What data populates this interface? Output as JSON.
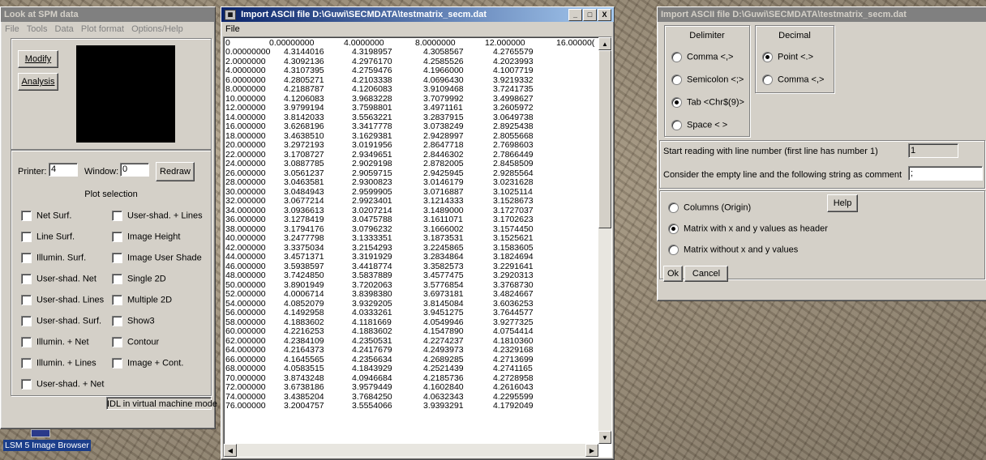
{
  "spm_window": {
    "title": "Look at SPM data",
    "menu": [
      "File",
      "Tools",
      "Data",
      "Plot format",
      "Options/Help"
    ],
    "modify_label": "Modify",
    "analysis_label": "Analysis",
    "printer_label": "Printer:",
    "printer_value": "4",
    "window_label": "Window:",
    "window_value": "0",
    "redraw_label": "Redraw",
    "plot_selection_title": "Plot selection",
    "plot_options_left": [
      "Net Surf.",
      "Line Surf.",
      "Illumin. Surf.",
      "User-shad. Net",
      "User-shad. Lines",
      "User-shad. Surf.",
      "Illumin. + Net",
      "Illumin. + Lines",
      "User-shad. + Net"
    ],
    "plot_options_right": [
      "User-shad. + Lines",
      "Image Height",
      "Image User Shade",
      "Single 2D",
      "Multiple 2D",
      "Show3",
      "Contour",
      "Image + Cont."
    ],
    "status_text": "IDL in virtual machine mode"
  },
  "import_table_window": {
    "title": "Import ASCII file D:\\Guwi\\SECMDATA\\testmatrix_secm.dat",
    "menu_file": "File",
    "minimize_glyph": "_",
    "maximize_glyph": "□",
    "close_glyph": "X",
    "header_row": [
      "0",
      "0.00000000",
      "4.0000000",
      "8.0000000",
      "12.000000",
      "16.00000("
    ],
    "rows": [
      [
        "0.00000000",
        "4.3144016",
        "4.3198957",
        "4.3058567",
        "4.2765579"
      ],
      [
        "2.0000000",
        "4.3092136",
        "4.2976170",
        "4.2585526",
        "4.2023993"
      ],
      [
        "4.0000000",
        "4.3107395",
        "4.2759476",
        "4.1966000",
        "4.1007719"
      ],
      [
        "6.0000000",
        "4.2805271",
        "4.2103338",
        "4.0696430",
        "3.9219332"
      ],
      [
        "8.0000000",
        "4.2188787",
        "4.1206083",
        "3.9109468",
        "3.7241735"
      ],
      [
        "10.000000",
        "4.1206083",
        "3.9683228",
        "3.7079992",
        "3.4998627"
      ],
      [
        "12.000000",
        "3.9799194",
        "3.7598801",
        "3.4971161",
        "3.2605972"
      ],
      [
        "14.000000",
        "3.8142033",
        "3.5563221",
        "3.2837915",
        "3.0649738"
      ],
      [
        "16.000000",
        "3.6268196",
        "3.3417778",
        "3.0738249",
        "2.8925438"
      ],
      [
        "18.000000",
        "3.4638510",
        "3.1629381",
        "2.9428997",
        "2.8055668"
      ],
      [
        "20.000000",
        "3.2972193",
        "3.0191956",
        "2.8647718",
        "2.7698603"
      ],
      [
        "22.000000",
        "3.1708727",
        "2.9349651",
        "2.8446302",
        "2.7866449"
      ],
      [
        "24.000000",
        "3.0887785",
        "2.9029198",
        "2.8782005",
        "2.8458509"
      ],
      [
        "26.000000",
        "3.0561237",
        "2.9059715",
        "2.9425945",
        "2.9285564"
      ],
      [
        "28.000000",
        "3.0463581",
        "2.9300823",
        "3.0146179",
        "3.0231628"
      ],
      [
        "30.000000",
        "3.0484943",
        "2.9599905",
        "3.0716887",
        "3.1025114"
      ],
      [
        "32.000000",
        "3.0677214",
        "2.9923401",
        "3.1214333",
        "3.1528673"
      ],
      [
        "34.000000",
        "3.0936613",
        "3.0207214",
        "3.1489000",
        "3.1727037"
      ],
      [
        "36.000000",
        "3.1278419",
        "3.0475788",
        "3.1611071",
        "3.1702623"
      ],
      [
        "38.000000",
        "3.1794176",
        "3.0796232",
        "3.1666002",
        "3.1574450"
      ],
      [
        "40.000000",
        "3.2477798",
        "3.1333351",
        "3.1873531",
        "3.1525621"
      ],
      [
        "42.000000",
        "3.3375034",
        "3.2154293",
        "3.2245865",
        "3.1583605"
      ],
      [
        "44.000000",
        "3.4571371",
        "3.3191929",
        "3.2834864",
        "3.1824694"
      ],
      [
        "46.000000",
        "3.5938597",
        "3.4418774",
        "3.3582573",
        "3.2291641"
      ],
      [
        "48.000000",
        "3.7424850",
        "3.5837889",
        "3.4577475",
        "3.2920313"
      ],
      [
        "50.000000",
        "3.8901949",
        "3.7202063",
        "3.5776854",
        "3.3768730"
      ],
      [
        "52.000000",
        "4.0006714",
        "3.8398380",
        "3.6973181",
        "3.4824667"
      ],
      [
        "54.000000",
        "4.0852079",
        "3.9329205",
        "3.8145084",
        "3.6036253"
      ],
      [
        "56.000000",
        "4.1492958",
        "4.0333261",
        "3.9451275",
        "3.7644577"
      ],
      [
        "58.000000",
        "4.1883602",
        "4.1181669",
        "4.0549946",
        "3.9277325"
      ],
      [
        "60.000000",
        "4.2216253",
        "4.1883602",
        "4.1547890",
        "4.0754414"
      ],
      [
        "62.000000",
        "4.2384109",
        "4.2350531",
        "4.2274237",
        "4.1810360"
      ],
      [
        "64.000000",
        "4.2164373",
        "4.2417679",
        "4.2493973",
        "4.2329168"
      ],
      [
        "66.000000",
        "4.1645565",
        "4.2356634",
        "4.2689285",
        "4.2713699"
      ],
      [
        "68.000000",
        "4.0583515",
        "4.1843929",
        "4.2521439",
        "4.2741165"
      ],
      [
        "70.000000",
        "3.8743248",
        "4.0946684",
        "4.2185736",
        "4.2728958"
      ],
      [
        "72.000000",
        "3.6738186",
        "3.9579449",
        "4.1602840",
        "4.2616043"
      ],
      [
        "74.000000",
        "3.4385204",
        "3.7684250",
        "4.0632343",
        "4.2295599"
      ],
      [
        "76.000000",
        "3.2004757",
        "3.5554066",
        "3.9393291",
        "4.1792049"
      ]
    ]
  },
  "import_options_window": {
    "title": "Import ASCII file D:\\Guwi\\SECMDATA\\testmatrix_secm.dat",
    "delimiter_title": "Delimiter",
    "delimiter_options": [
      "Comma <,>",
      "Semicolon <;>",
      "Tab <Chr$(9)>",
      "Space < >"
    ],
    "delimiter_selected": "Tab <Chr$(9)>",
    "decimal_title": "Decimal",
    "decimal_options": [
      "Point <.>",
      "Comma <,>"
    ],
    "decimal_selected": "Point <.>",
    "start_line_label": "Start reading with line number (first line has number 1)",
    "start_line_value": "1",
    "comment_label": "Consider the empty line and the following string as comment",
    "comment_value": ";",
    "format_options": [
      "Columns (Origin)",
      "Matrix with x and y values as header",
      "Matrix without x and y values"
    ],
    "format_selected": "Matrix with x and y values as header",
    "help_label": "Help",
    "ok_label": "Ok",
    "cancel_label": "Cancel"
  },
  "desktop": {
    "taskbar_icon_label": "LSM 5 Image Browser"
  },
  "colors": {
    "window_face": "#d4d0c8",
    "active_title_start": "#0a246a",
    "active_title_end": "#a6caf0",
    "inactive_title": "#808080",
    "preview_canvas": "#000000"
  }
}
